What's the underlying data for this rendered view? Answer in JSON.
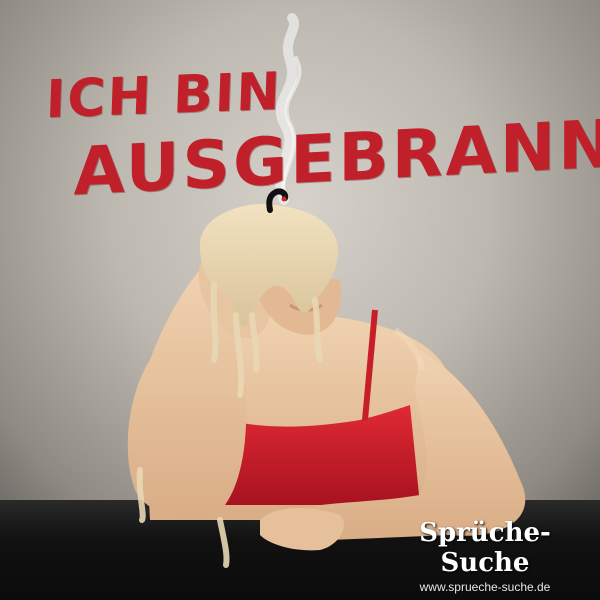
{
  "headline": {
    "line1": "ICH BIN",
    "line2": "AUSGEBRANNT"
  },
  "logo": {
    "name": "Sprüche-Suche",
    "url": "www.sprueche-suche.de"
  },
  "colors": {
    "headline": "#c0202a",
    "wall": "#c8c3bb",
    "table": "#111111",
    "top": "#d5222d",
    "wax": "#e8d7b5"
  },
  "image": {
    "subject": "candle-head-person",
    "description_icons": [
      "smoke-icon",
      "wick-icon"
    ]
  }
}
